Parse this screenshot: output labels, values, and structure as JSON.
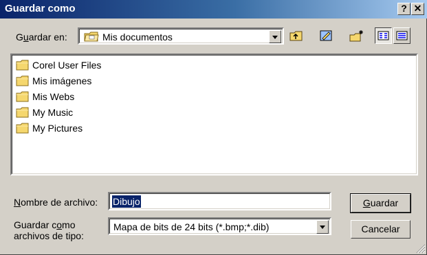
{
  "window": {
    "title": "Guardar como"
  },
  "titlebar": {
    "help_glyph": "?",
    "close_glyph": "✕"
  },
  "save_in": {
    "label_pre": "G",
    "label_ul": "u",
    "label_post": "ardar en:",
    "value": "Mis documentos",
    "icon": "my-documents-folder-icon"
  },
  "toolbar": {
    "buttons": [
      "up-one-level-icon",
      "desktop-icon",
      "new-folder-icon",
      "list-view-icon",
      "details-view-icon"
    ]
  },
  "files": [
    {
      "name": "Corel User Files",
      "icon": "folder-icon"
    },
    {
      "name": "Mis imágenes",
      "icon": "folder-icon"
    },
    {
      "name": "Mis Webs",
      "icon": "folder-icon"
    },
    {
      "name": "My Music",
      "icon": "folder-icon"
    },
    {
      "name": "My Pictures",
      "icon": "folder-icon"
    }
  ],
  "filename": {
    "label_ul": "N",
    "label_post": "ombre de archivo:",
    "value": "Dibujo"
  },
  "filetype": {
    "label_line1_pre": "Guardar c",
    "label_line1_ul": "o",
    "label_line1_post": "mo",
    "label_line2": "archivos de tipo:",
    "value": "Mapa de bits de 24 bits (*.bmp;*.dib)"
  },
  "buttons": {
    "save_ul": "G",
    "save_post": "uardar",
    "cancel": "Cancelar"
  },
  "colors": {
    "selection": "#0a246a",
    "folder": "#f5d76e"
  }
}
